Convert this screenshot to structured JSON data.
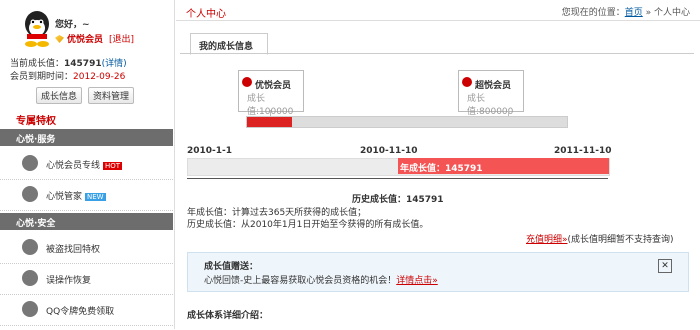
{
  "sidebar": {
    "greeting": "您好，~",
    "vip_label": "优悦会员",
    "logout": "[退出]",
    "growth_label": "当前成长值：",
    "growth_value": "145791",
    "growth_link": "(详情)",
    "expire_label": "会员到期时间：",
    "expire_value": "2012-09-26",
    "btn_growth": "成长信息",
    "btn_profile": "资料管理",
    "privileges_title": "专属特权",
    "section1": "心悦·服务",
    "item_expert": "心悦会员专线",
    "item_expert_tag": "HOT",
    "item_manager": "心悦管家",
    "item_manager_tag": "NEW",
    "section2": "心悦·安全",
    "item_recover": "被盗找回特权",
    "item_undo": "误操作恢复",
    "item_token": "QQ令牌免费领取"
  },
  "header": {
    "title": "个人中心",
    "crumb_prefix": "您现在的位置：",
    "crumb_home": "首页",
    "crumb_current": "» 个人中心"
  },
  "tab": "我的成长信息",
  "levels": {
    "vip_name": "优悦会员",
    "vip_value": "成长值:100000",
    "super_name": "超悦会员",
    "super_value": "成长值:800000"
  },
  "level_progress": 0.14,
  "timeline": {
    "date_start": "2010-1-1",
    "date_mid": "2010-11-10",
    "date_end": "2011-11-10",
    "current": "年成长值：145791",
    "current_fraction": 0.5,
    "history": "历史成长值：145791"
  },
  "desc1": "年成长值：计算过去365天所获得的成长值；",
  "desc2": "历史成长值：从2010年1月1日开始至今获得的所有成长值。",
  "record_link": "充值明细»",
  "record_note": "(成长值明细暂不支持查询)",
  "gift": {
    "title": "成长值赠送：",
    "text": "心悦回馈-史上最容易获取心悦会员资格的机会！",
    "link": "详情点击»",
    "close": "✕"
  },
  "intro": "成长体系详细介绍："
}
